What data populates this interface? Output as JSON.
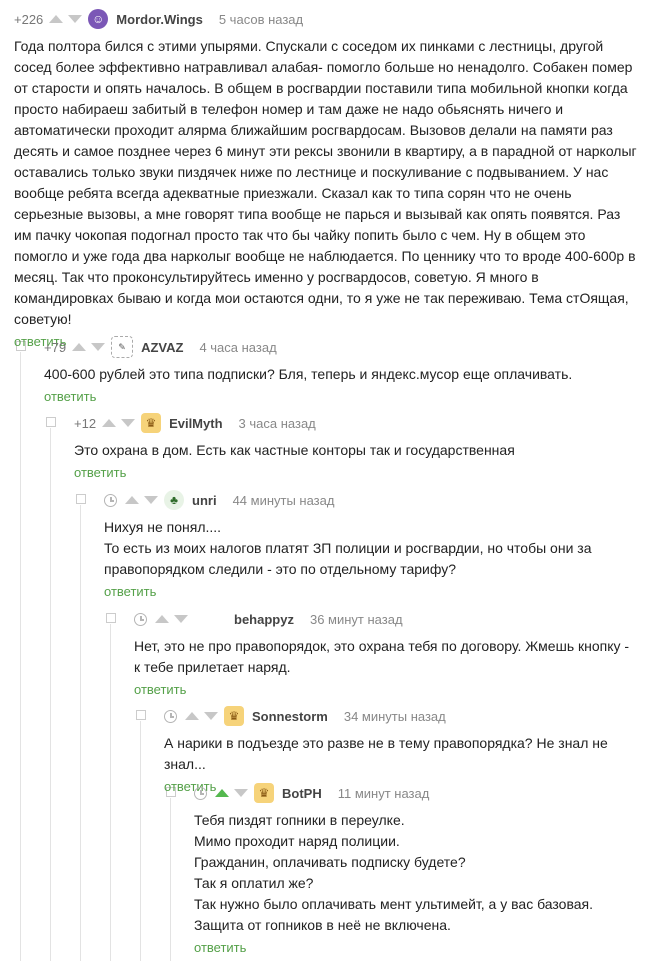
{
  "reply_label": "ответить",
  "colors": {
    "accent": "#54a048",
    "vote_active": "#54b84e",
    "vote_inactive": "#c7c7c7"
  },
  "comments": [
    {
      "rating": "+226",
      "user": "Mordor.Wings",
      "avatar_icon": "mordor-avatar-icon",
      "time": "5 часов назад",
      "lines": [
        "Года полтора бился с этими упырями. Спускали с соседом их пинками с лестницы, другой сосед более эффективно натравливал алабая- помогло больше но ненадолго. Собакен помер от старости и опять началось. В общем в росгвардии поставили типа мобильной кнопки когда просто набираеш забитый в телефон номер и там даже не надо обьяснять ничего и автоматически проходит алярма ближайшим росгвардосам. Вызовов делали на памяти раз десять и самое позднее через 6 минут эти рексы звонили в квартиру, а в парадной от нарколыг оставались только звуки пиздячек ниже по лестнице и поскуливание с подвыванием. У нас вообще ребята всегда адекватные приезжали. Сказал как то типа сорян что не очень серьезные вызовы, а мне говорят типа вообще не парься и вызывай как опять появятся. Раз им пачку чокопая подогнал просто так что бы чайку попить было с чем. Ну в общем это помогло и уже года два нарколыг вообще не наблюдается. По ценнику что то вроде 400-600р в месяц. Так что проконсультируйтесь именно у росгвардосов, советую. Я много в командировках бываю и когда мои остаются одни, то я уже не так переживаю. Тема стОящая, советую!"
      ]
    },
    {
      "rating": "+79",
      "user": "AZVAZ",
      "avatar_icon": "azvaz-avatar-icon",
      "time": "4 часа назад",
      "lines": [
        "400-600 рублей это типа подписки? Бля, теперь и яндекс.мусор еще оплачивать."
      ]
    },
    {
      "rating": "+12",
      "user": "EvilMyth",
      "avatar_icon": "cat-avatar-icon",
      "time": "3 часа назад",
      "lines": [
        "Это охрана в дом. Есть как частные конторы так и государственная"
      ]
    },
    {
      "rating": "",
      "user": "unri",
      "avatar_icon": "unri-avatar-icon",
      "time": "44 минуты назад",
      "lines": [
        "Нихуя не понял....",
        "То есть из моих налогов платят ЗП полиции и росгвардии, но чтобы они за правопорядком следили - это по отдельному тарифу?"
      ]
    },
    {
      "rating": "",
      "user": "behappyz",
      "avatar_icon": "",
      "time": "36 минут назад",
      "lines": [
        "Нет, это не про правопорядок, это охрана тебя по договору. Жмешь кнопку - к тебе прилетает наряд."
      ]
    },
    {
      "rating": "",
      "user": "Sonnestorm",
      "avatar_icon": "cat-avatar-icon",
      "time": "34 минуты назад",
      "lines": [
        "А нарики в подъезде это разве не в тему правопорядка? Не знал не знал..."
      ]
    },
    {
      "rating": "",
      "user": "BotPH",
      "avatar_icon": "cat-avatar-icon",
      "time": "11 минут назад",
      "lines": [
        "Тебя пиздят гопники в переулке.",
        "Мимо проходит наряд полиции.",
        "Гражданин, оплачивать подписку будете?",
        "Так я оплатил же?",
        "Так нужно было оплачивать мент ультимейт, а у вас базовая. Защита от гопников в неё не включена."
      ]
    }
  ]
}
